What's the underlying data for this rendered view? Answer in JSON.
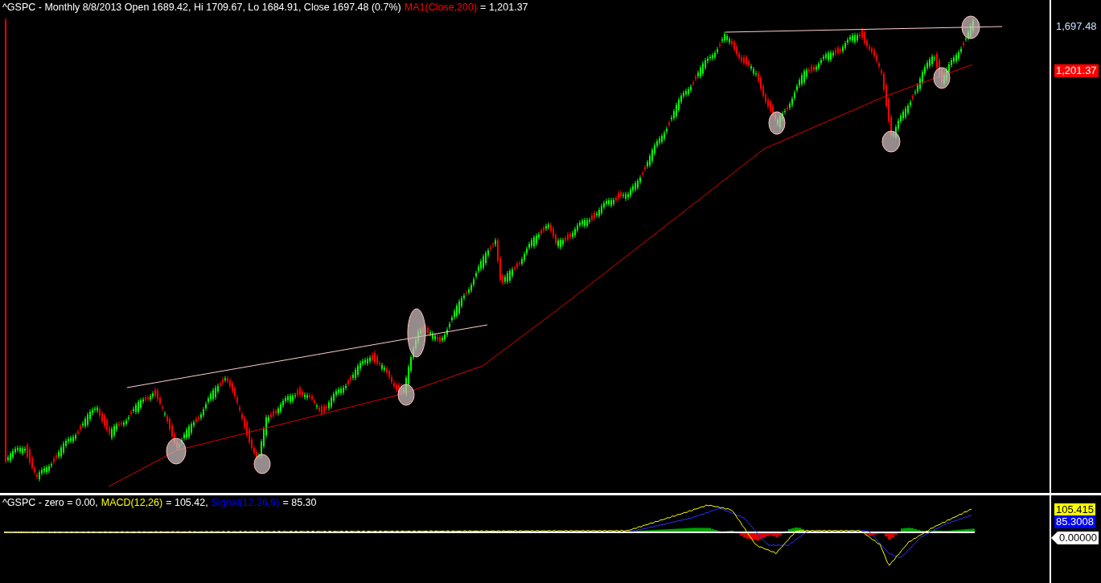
{
  "price_pane": {
    "legend": [
      {
        "text": "^GSPC - Monthly 8/8/2013 Open 1689.42, Hi 1709.67, Lo 1684.91, Close 1697.48 (0.7%)",
        "color": "#ffffff"
      },
      {
        "text": "MA1(Close,200)",
        "color": "#ff0000"
      },
      {
        "text": "= 1,201.37",
        "color": "#ffffff"
      }
    ],
    "axis_labels": [
      {
        "text": "1,697.48",
        "kind": "plain",
        "color": "#c8e0ff"
      },
      {
        "text": "1,201.37",
        "kind": "filled",
        "color": "#ff0000"
      }
    ]
  },
  "macd_pane": {
    "legend": [
      {
        "text": "^GSPC - zero = 0.00,",
        "color": "#ffffff"
      },
      {
        "text": "MACD(12,26)",
        "color": "#ffff00"
      },
      {
        "text": "= 105.42,",
        "color": "#ffffff"
      },
      {
        "text": "Signal(12,26,9)",
        "color": "#0000ff"
      },
      {
        "text": "= 85.30",
        "color": "#ffffff"
      }
    ],
    "axis_labels": [
      {
        "text": "105.415",
        "kind": "filled",
        "color": "#ffff00"
      },
      {
        "text": "85.3008",
        "kind": "filled",
        "color": "#0000ff"
      },
      {
        "text": "0.00000",
        "kind": "tag",
        "color": "#ffffff"
      }
    ]
  }
}
